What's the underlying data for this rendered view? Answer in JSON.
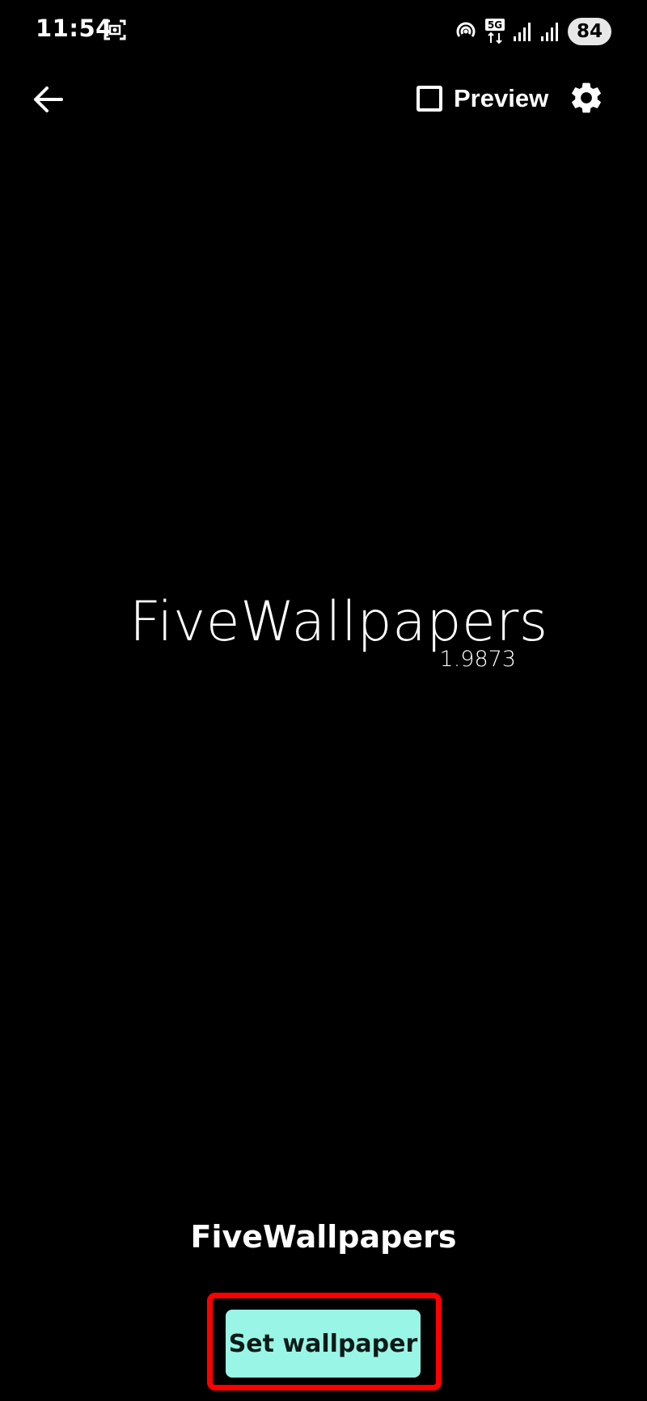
{
  "status_bar": {
    "time": "11:54",
    "network_badge": "5G",
    "battery_level": "84",
    "icons": [
      "screenshot-icon",
      "hotspot-icon",
      "network-5g-icon",
      "signal-icon",
      "signal-icon",
      "battery-icon"
    ]
  },
  "toolbar": {
    "back_icon": "arrow-left-icon",
    "preview_label": "Preview",
    "preview_checked": false,
    "settings_icon": "gear-icon"
  },
  "preview": {
    "logo_title": "FiveWallpapers",
    "logo_version": "1.9873"
  },
  "footer": {
    "wallpaper_name": "FiveWallpapers",
    "set_wallpaper_label": "Set wallpaper"
  },
  "colors": {
    "background": "#000000",
    "text": "#ffffff",
    "button_bg": "#99f6e6",
    "highlight": "#ff0000"
  }
}
